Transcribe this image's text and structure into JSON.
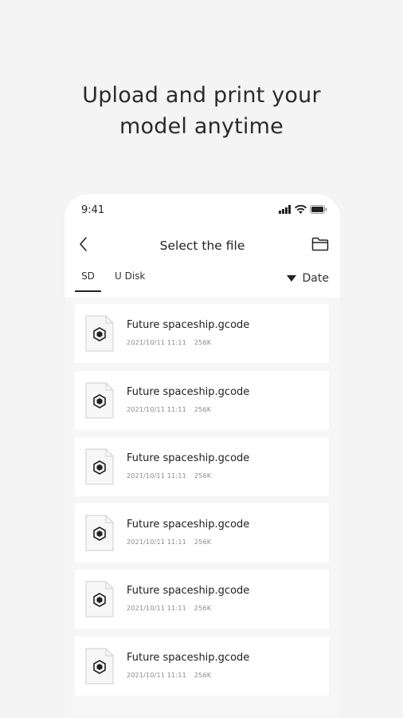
{
  "headline": {
    "line1": "Upload and print your",
    "line2": "model anytime"
  },
  "status_bar": {
    "time": "9:41"
  },
  "navbar": {
    "title": "Select the file"
  },
  "tabs": [
    {
      "label": "SD",
      "active": true
    },
    {
      "label": "U Disk",
      "active": false
    }
  ],
  "sort": {
    "label": "Date"
  },
  "files": [
    {
      "name": "Future spaceship.gcode",
      "date": "2021/10/11 11:11",
      "size": "256K"
    },
    {
      "name": "Future spaceship.gcode",
      "date": "2021/10/11 11:11",
      "size": "256K"
    },
    {
      "name": "Future spaceship.gcode",
      "date": "2021/10/11 11:11",
      "size": "256K"
    },
    {
      "name": "Future spaceship.gcode",
      "date": "2021/10/11 11:11",
      "size": "256K"
    },
    {
      "name": "Future spaceship.gcode",
      "date": "2021/10/11 11:11",
      "size": "256K"
    },
    {
      "name": "Future spaceship.gcode",
      "date": "2021/10/11 11:11",
      "size": "256K"
    }
  ],
  "icons": {
    "back": "chevron-left-icon",
    "folder": "folder-icon",
    "file": "gcode-file-icon",
    "sort": "triangle-down-icon",
    "signal": "signal-icon",
    "wifi": "wifi-icon",
    "battery": "battery-icon"
  },
  "colors": {
    "background": "#f4f4f4",
    "card": "#ffffff",
    "text": "#222222",
    "muted": "#888888"
  }
}
